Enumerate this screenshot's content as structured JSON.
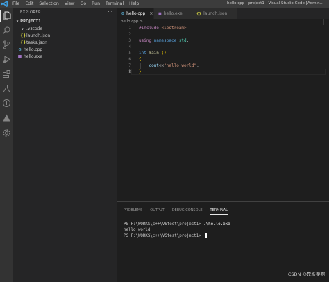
{
  "titlebar": {
    "menu": [
      "File",
      "Edit",
      "Selection",
      "View",
      "Go",
      "Run",
      "Terminal",
      "Help"
    ],
    "window_title": "hello.cpp - project1 - Visual Studio Code [Admin..."
  },
  "sidebar": {
    "header": "EXPLORER",
    "more": "···",
    "project": "PROJECT1",
    "items": [
      {
        "label": ".vscode",
        "icon": "chevron-down-icon"
      },
      {
        "label": "launch.json",
        "icon": "json-icon"
      },
      {
        "label": "tasks.json",
        "icon": "json-icon"
      },
      {
        "label": "hello.cpp",
        "icon": "cpp-icon"
      },
      {
        "label": "hello.exe",
        "icon": "exe-icon"
      }
    ]
  },
  "tabs": [
    {
      "label": "hello.cpp",
      "icon": "cpp-icon",
      "active": true
    },
    {
      "label": "hello.exe",
      "icon": "exe-icon",
      "active": false
    },
    {
      "label": "launch.json",
      "icon": "json-icon",
      "active": false
    }
  ],
  "breadcrumb": "hello.cpp > ...",
  "editor": {
    "line_numbers": [
      "1",
      "2",
      "3",
      "4",
      "5",
      "6",
      "7",
      "8"
    ],
    "current_line": "8",
    "lines": [
      {
        "t1": "#include ",
        "t2": "<iostream>"
      },
      {},
      {
        "t1": "using ",
        "t2": "namespace ",
        "t3": "std",
        "t4": ";"
      },
      {},
      {
        "t1": "int ",
        "t2": "main ",
        "t3": "()"
      },
      {
        "t1": "{"
      },
      {
        "t1": "    ",
        "t2": "cout",
        "t3": "<<",
        "t4": "\"hello world\"",
        "t5": ";"
      },
      {
        "t1": "}"
      }
    ]
  },
  "panel": {
    "tabs": [
      "PROBLEMS",
      "OUTPUT",
      "DEBUG CONSOLE",
      "TERMINAL"
    ],
    "active_tab": "TERMINAL",
    "terminal": [
      {
        "prompt": "PS F:\\WORKS\\c++\\VStest\\project1> ",
        "cmd": ".\\hello.exe"
      },
      {
        "prompt": "hello world",
        "cmd": ""
      },
      {
        "prompt": "PS F:\\WORKS\\c++\\VStest\\project1> ",
        "cmd": ""
      }
    ]
  },
  "watermark": "CSDN @是板栗啊"
}
